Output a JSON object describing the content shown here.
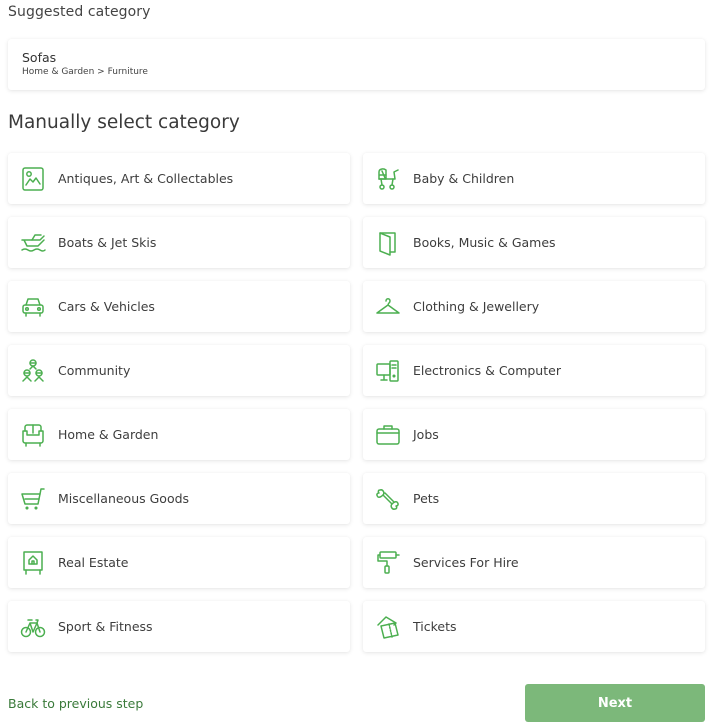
{
  "suggested": {
    "section_label": "Suggested category",
    "title": "Sofas",
    "path": "Home & Garden > Furniture"
  },
  "manual": {
    "heading": "Manually select category",
    "categories": [
      {
        "label": "Antiques, Art & Collectables",
        "icon": "picture-frame-icon"
      },
      {
        "label": "Baby & Children",
        "icon": "pram-icon"
      },
      {
        "label": "Boats & Jet Skis",
        "icon": "boat-icon"
      },
      {
        "label": "Books, Music & Games",
        "icon": "book-icon"
      },
      {
        "label": "Cars & Vehicles",
        "icon": "car-icon"
      },
      {
        "label": "Clothing & Jewellery",
        "icon": "hanger-icon"
      },
      {
        "label": "Community",
        "icon": "people-icon"
      },
      {
        "label": "Electronics & Computer",
        "icon": "computer-icon"
      },
      {
        "label": "Home & Garden",
        "icon": "sofa-icon"
      },
      {
        "label": "Jobs",
        "icon": "briefcase-icon"
      },
      {
        "label": "Miscellaneous Goods",
        "icon": "shopping-cart-icon"
      },
      {
        "label": "Pets",
        "icon": "bone-icon"
      },
      {
        "label": "Real Estate",
        "icon": "house-sign-icon"
      },
      {
        "label": "Services For Hire",
        "icon": "paint-roller-icon"
      },
      {
        "label": "Sport & Fitness",
        "icon": "bicycle-icon"
      },
      {
        "label": "Tickets",
        "icon": "tickets-icon"
      }
    ]
  },
  "footer": {
    "back_label": "Back to previous step",
    "next_label": "Next"
  },
  "colors": {
    "accent": "#4caf50",
    "next_button": "#7cb87a",
    "link": "#3a7a3a"
  }
}
